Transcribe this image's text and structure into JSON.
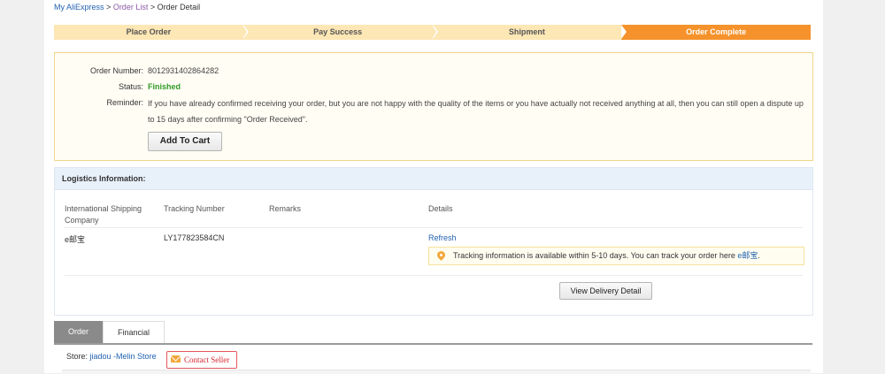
{
  "breadcrumb": {
    "home": "My AliExpress",
    "sep1": ">",
    "order_list": "Order List",
    "sep2": ">",
    "current": "Order Detail"
  },
  "steps": [
    {
      "label": "Place Order",
      "state": "done"
    },
    {
      "label": "Pay Success",
      "state": "done"
    },
    {
      "label": "Shipment",
      "state": "done"
    },
    {
      "label": "Order Complete",
      "state": "active"
    }
  ],
  "order": {
    "number_label": "Order Number:",
    "number": "8012931402864282",
    "status_label": "Status:",
    "status": "Finished",
    "reminder_label": "Reminder:",
    "reminder": "If you have already confirmed receiving your order, but you are not happy with the quality of the items or you have actually not received anything at all, then you can still open a dispute up to 15 days after confirming \"Order Received\".",
    "add_to_cart": "Add To Cart"
  },
  "logistics": {
    "title": "Logistics Information:",
    "columns": [
      "International Shipping Company",
      "Tracking Number",
      "Remarks",
      "Details"
    ],
    "row": {
      "company": "e邮宝",
      "tracking": "LY177823584CN",
      "remarks": "",
      "details_link": "Refresh"
    },
    "notice_text": "Tracking information is available within 5-10 days. You can track your order here",
    "notice_link": "e邮宝",
    "notice_end": ".",
    "view_delivery": "View Delivery Detail"
  },
  "tabs": [
    {
      "label": "Order",
      "active": true
    },
    {
      "label": "Financial",
      "active": false
    }
  ],
  "store": {
    "label": "Store:",
    "name": "jiadou -Melin Store",
    "contact": "Contact Seller"
  },
  "colors": {
    "accent": "#f5922b",
    "step_bg": "#fde7b5",
    "link": "#2262b2",
    "status_green": "#2f9a27"
  }
}
